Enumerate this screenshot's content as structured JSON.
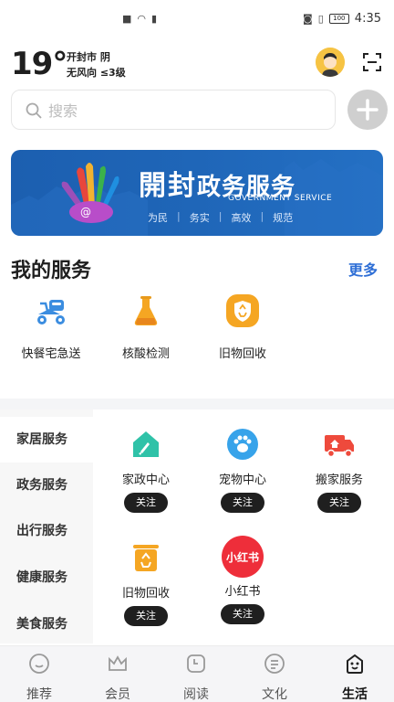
{
  "status_bar": {
    "time": "4:35",
    "battery": "100"
  },
  "weather": {
    "temperature": "19°",
    "city_condition": "开封市 阴",
    "wind": "无风向 ≤3级"
  },
  "search": {
    "placeholder": "搜索"
  },
  "banner": {
    "title_main": "開封",
    "title_sub": "政务服务",
    "subtitle_en": "GOVERNMENT SERVICE",
    "slogans": [
      "为民",
      "务实",
      "高效",
      "规范"
    ]
  },
  "my_services": {
    "title": "我的服务",
    "more_label": "更多",
    "items": [
      {
        "label": "快餐宅急送",
        "icon": "delivery-scooter-icon"
      },
      {
        "label": "核酸检测",
        "icon": "test-flask-icon"
      },
      {
        "label": "旧物回收",
        "icon": "recycle-shield-icon"
      }
    ]
  },
  "categories": [
    "家居服务",
    "政务服务",
    "出行服务",
    "健康服务",
    "美食服务"
  ],
  "category_items": [
    {
      "label": "家政中心",
      "icon": "house-cleaning-icon",
      "action": "关注"
    },
    {
      "label": "宠物中心",
      "icon": "paw-icon",
      "action": "关注"
    },
    {
      "label": "搬家服务",
      "icon": "moving-truck-icon",
      "action": "关注"
    },
    {
      "label": "旧物回收",
      "icon": "recycle-bin-icon",
      "action": "关注"
    },
    {
      "label": "小红书",
      "icon": "xiaohongshu-logo-icon",
      "logo_text": "小红书",
      "action": "关注"
    }
  ],
  "bottom_nav": [
    {
      "label": "推荐",
      "icon": "recommend-icon"
    },
    {
      "label": "会员",
      "icon": "crown-icon"
    },
    {
      "label": "阅读",
      "icon": "read-icon"
    },
    {
      "label": "文化",
      "icon": "culture-icon"
    },
    {
      "label": "生活",
      "icon": "life-icon"
    }
  ],
  "colors": {
    "accent": "#2f6fd6",
    "banner": "#1f66b8",
    "xiaohongshu": "#ee2e3a"
  }
}
